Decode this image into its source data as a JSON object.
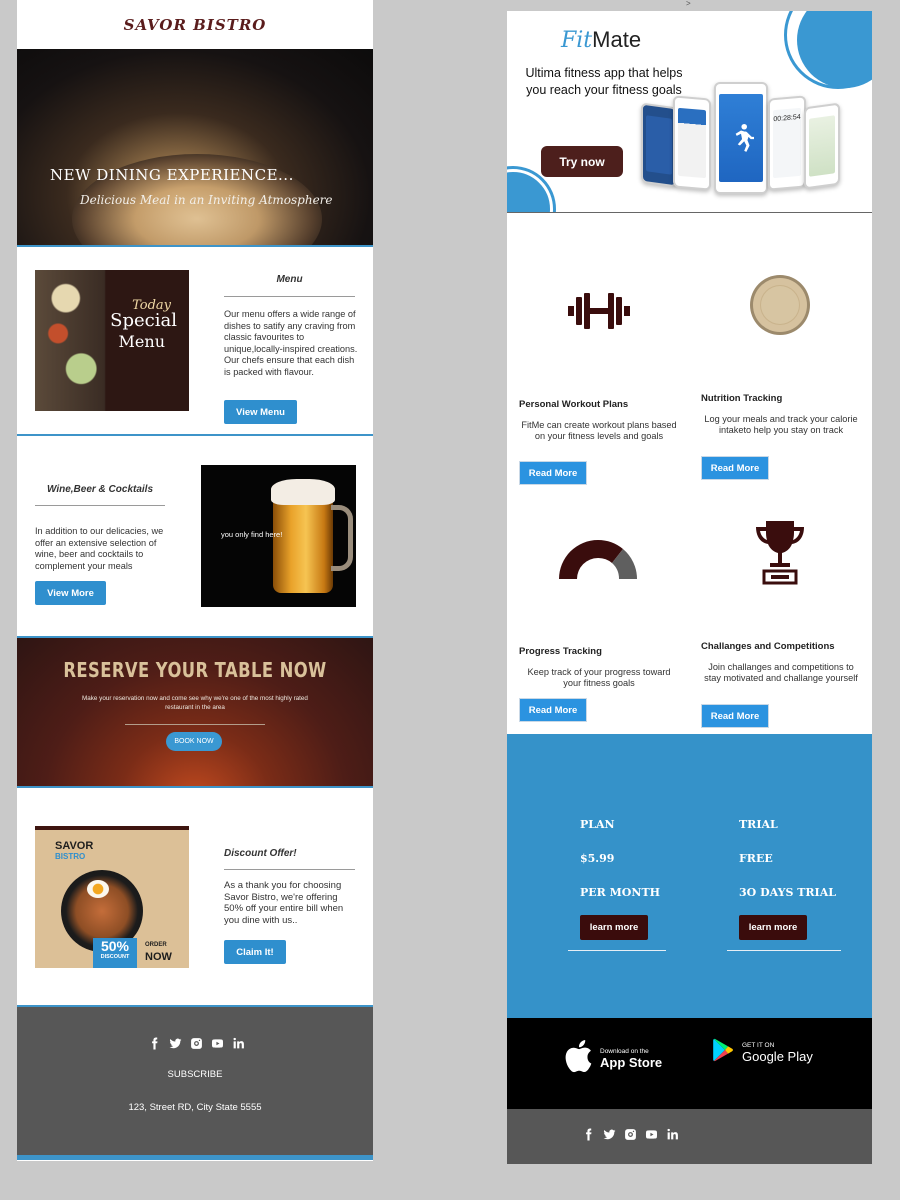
{
  "bistro": {
    "logo": "SAVOR BISTRO",
    "hero": {
      "title": "NEW DINING EXPERIENCE...",
      "subtitle": "Delicious Meal in an Inviting Atmosphere"
    },
    "menu": {
      "image_text": [
        "Today",
        "Special",
        "Menu"
      ],
      "title": "Menu",
      "text": "Our menu offers a wide range of dishes to satify any craving from classic favourites to unique,locally-inspired creations. Our chefs ensure that each dish is packed with flavour.",
      "button": "View Menu"
    },
    "wine": {
      "title": "Wine,Beer & Cocktails",
      "text": "In addition to our delicacies, we offer an extensive selection of wine, beer and cocktails to complement your meals",
      "button": "View More",
      "image_text": "you only find here!"
    },
    "reserve": {
      "title": "RESERVE YOUR TABLE NOW",
      "text": "Make your reservation now and come see why we're one of the most highly rated restaurant in the area",
      "button": "BOOK NOW"
    },
    "discount": {
      "image": {
        "brand_top": "SAVOR",
        "brand_bottom": "BISTRO",
        "percent": "50%",
        "label": "DISCOUNT",
        "order": "ORDER",
        "now": "NOW"
      },
      "title": "Discount Offer!",
      "text": "As a thank you for choosing Savor Bistro, we're offering 50% off your entire bill when you dine with us..",
      "button": "Claim It!"
    },
    "footer": {
      "socials": [
        "facebook-icon",
        "twitter-icon",
        "instagram-icon",
        "youtube-icon",
        "linkedin-icon"
      ],
      "subscribe": "SUBSCRIBE",
      "address": "123, Street RD, City State 5555"
    }
  },
  "misc": {
    "top_mark": ">"
  },
  "fitmate": {
    "logo_prefix": "Fit",
    "logo_suffix": "Mate",
    "tagline": "Ultima fitness app that helps you reach your fitness goals",
    "cta": "Try now",
    "phone_screen_time": "00:28:54",
    "features": [
      {
        "icon": "dumbbell-icon",
        "title": "Personal Workout Plans",
        "text": "FitMe can create workout plans based on your fitness levels and goals",
        "button": "Read More"
      },
      {
        "icon": "plate-icon",
        "title": "Nutrition Tracking",
        "text": "Log your meals and track your calorie intaketo help you stay on track",
        "button": "Read More"
      },
      {
        "icon": "gauge-icon",
        "title": "Progress Tracking",
        "text": "Keep track of your progress toward your fitness goals",
        "button": "Read More"
      },
      {
        "icon": "trophy-icon",
        "title": "Challanges and Competitions",
        "text": "Join challanges and competitions to stay motivated and challange yourself",
        "button": "Read More"
      }
    ],
    "plans": [
      {
        "line1": "PLAN",
        "line2": "$5.99",
        "line3": "PER MONTH",
        "button": "learn more"
      },
      {
        "line1": "TRIAL",
        "line2": "FREE",
        "line3": "3O DAYS TRIAL",
        "button": "learn more"
      }
    ],
    "app_store": {
      "small": "Download on the",
      "big": "App Store"
    },
    "google_play": {
      "small": "GET IT ON",
      "big": "Google Play"
    },
    "footer_socials": [
      "facebook-icon",
      "twitter-icon",
      "instagram-icon",
      "youtube-icon",
      "linkedin-icon"
    ],
    "colors": {
      "accent": "#3592c9",
      "button_blue": "#2b93e0",
      "dark_maroon": "#4d1f1c"
    }
  }
}
